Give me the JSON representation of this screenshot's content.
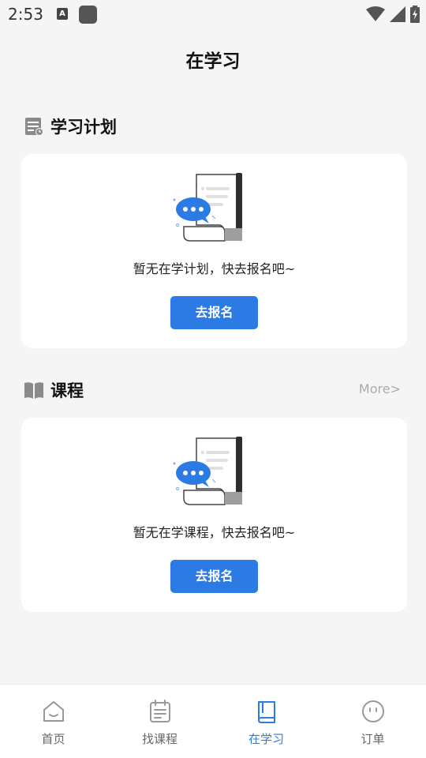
{
  "status_bar": {
    "time": "2:53",
    "badge_letter": "A",
    "icons": [
      "notification-a-icon",
      "app-icon",
      "wifi-icon",
      "signal-icon",
      "battery-charging-icon"
    ]
  },
  "page": {
    "title": "在学习"
  },
  "plan_section": {
    "title": "学习计划",
    "icon": "calendar-note-icon",
    "empty_text": "暂无在学计划，快去报名吧~",
    "button_label": "去报名"
  },
  "course_section": {
    "title": "课程",
    "icon": "book-icon",
    "more_label": "More>",
    "empty_text": "暂无在学课程，快去报名吧~",
    "button_label": "去报名"
  },
  "tabbar": {
    "items": [
      {
        "label": "首页",
        "icon": "home-icon"
      },
      {
        "label": "找课程",
        "icon": "course-list-icon"
      },
      {
        "label": "在学习",
        "icon": "book-icon",
        "active": true
      },
      {
        "label": "订单",
        "icon": "smile-face-icon"
      }
    ]
  },
  "colors": {
    "accent": "#2c7be5",
    "background": "#f5f5f5",
    "card": "#ffffff",
    "muted": "#aaaaaa"
  }
}
